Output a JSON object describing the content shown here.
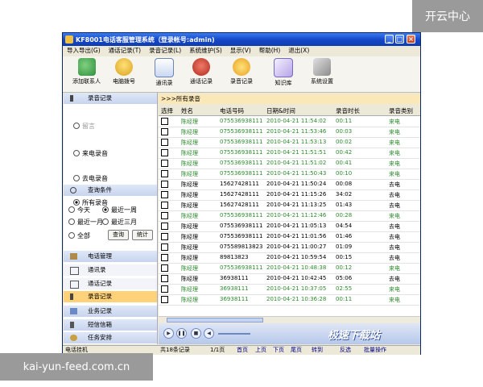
{
  "watermark": {
    "top_right": "开云中心",
    "bottom_left": "kai-yun-feed.com.cn"
  },
  "window": {
    "title": "KF8001电话客服管理系统（登录帐号:admin)",
    "min": "_",
    "max": "□",
    "close": "×"
  },
  "menu": [
    "导入导出(G)",
    "通话记录(T)",
    "录音记录(L)",
    "系统维护(S)",
    "显示(V)",
    "帮助(H)",
    "退出(X)"
  ],
  "toolbar": [
    "添加联系人",
    "电脑拨号",
    "通讯录",
    "通话记录",
    "录音记录",
    "知识库",
    "系统设置"
  ],
  "sidebar": {
    "recordings_header": "录音记录",
    "r_missed": "留言",
    "r_incoming": "来电录音",
    "r_outgoing": "去电录音",
    "query_header": "查询条件",
    "q_all_rec": "所有录音",
    "q_today": "今天",
    "q_week": "最近一周",
    "q_month": "最近一月",
    "q_3months": "最近三月",
    "q_all": "全部",
    "btn_query": "查询",
    "btn_stats": "统计",
    "nav": [
      "电话管理",
      "通讯录",
      "通话记录",
      "录音记录",
      "业务记录",
      "短信信箱",
      "任务安排"
    ]
  },
  "breadcrumb": ">>>所有录音",
  "table": {
    "headers": [
      "选择",
      "姓名",
      "电话号码",
      "日期&时间",
      "录音时长",
      "录音类别"
    ],
    "rows": [
      {
        "name": "陈经理",
        "phone": "075536938111",
        "time": "2010-04-21 11:54:02",
        "dur": "00:11",
        "type": "来电",
        "g": true
      },
      {
        "name": "陈经理",
        "phone": "075536938111",
        "time": "2010-04-21 11:53:46",
        "dur": "00:03",
        "type": "来电",
        "g": true
      },
      {
        "name": "陈经理",
        "phone": "075536938111",
        "time": "2010-04-21 11:53:13",
        "dur": "00:02",
        "type": "来电",
        "g": true
      },
      {
        "name": "陈经理",
        "phone": "075536938111",
        "time": "2010-04-21 11:51:51",
        "dur": "00:42",
        "type": "来电",
        "g": true
      },
      {
        "name": "陈经理",
        "phone": "075536938111",
        "time": "2010-04-21 11:51:02",
        "dur": "00:41",
        "type": "来电",
        "g": true
      },
      {
        "name": "陈经理",
        "phone": "075536938111",
        "time": "2010-04-21 11:50:43",
        "dur": "00:10",
        "type": "来电",
        "g": true
      },
      {
        "name": "陈经理",
        "phone": "15627428111",
        "time": "2010-04-21 11:50:24",
        "dur": "00:08",
        "type": "去电",
        "g": false
      },
      {
        "name": "陈经理",
        "phone": "15627428111",
        "time": "2010-04-21 11:15:26",
        "dur": "34:02",
        "type": "去电",
        "g": false
      },
      {
        "name": "陈经理",
        "phone": "15627428111",
        "time": "2010-04-21 11:13:25",
        "dur": "01:43",
        "type": "去电",
        "g": false
      },
      {
        "name": "陈经理",
        "phone": "075536938111",
        "time": "2010-04-21 11:12:46",
        "dur": "00:28",
        "type": "来电",
        "g": true
      },
      {
        "name": "陈经理",
        "phone": "075536938111",
        "time": "2010-04-21 11:05:13",
        "dur": "04:54",
        "type": "去电",
        "g": false
      },
      {
        "name": "陈经理",
        "phone": "075536938111",
        "time": "2010-04-21 11:01:56",
        "dur": "01:46",
        "type": "去电",
        "g": false
      },
      {
        "name": "陈经理",
        "phone": "075589813823",
        "time": "2010-04-21 11:00:27",
        "dur": "01:09",
        "type": "去电",
        "g": false
      },
      {
        "name": "陈经理",
        "phone": "89813823",
        "time": "2010-04-21 10:59:54",
        "dur": "00:15",
        "type": "去电",
        "g": false
      },
      {
        "name": "陈经理",
        "phone": "075536938111",
        "time": "2010-04-21 10:48:38",
        "dur": "00:12",
        "type": "来电",
        "g": true
      },
      {
        "name": "陈经理",
        "phone": "36938111",
        "time": "2010-04-21 10:42:45",
        "dur": "05:06",
        "type": "去电",
        "g": false
      },
      {
        "name": "陈经理",
        "phone": "36938111",
        "time": "2010-04-21 10:37:05",
        "dur": "02:55",
        "type": "来电",
        "g": true
      },
      {
        "name": "陈经理",
        "phone": "36938111",
        "time": "2010-04-21 10:36:28",
        "dur": "00:11",
        "type": "来电",
        "g": true
      }
    ]
  },
  "player_brand": "极速下载站",
  "status": {
    "left": "电话挂机",
    "count": "共18条记录",
    "page": "1/1页",
    "first": "首页",
    "prev": "上页",
    "next": "下页",
    "last": "尾页",
    "goto": "转到",
    "invert": "反选",
    "batch": "批量操作"
  }
}
